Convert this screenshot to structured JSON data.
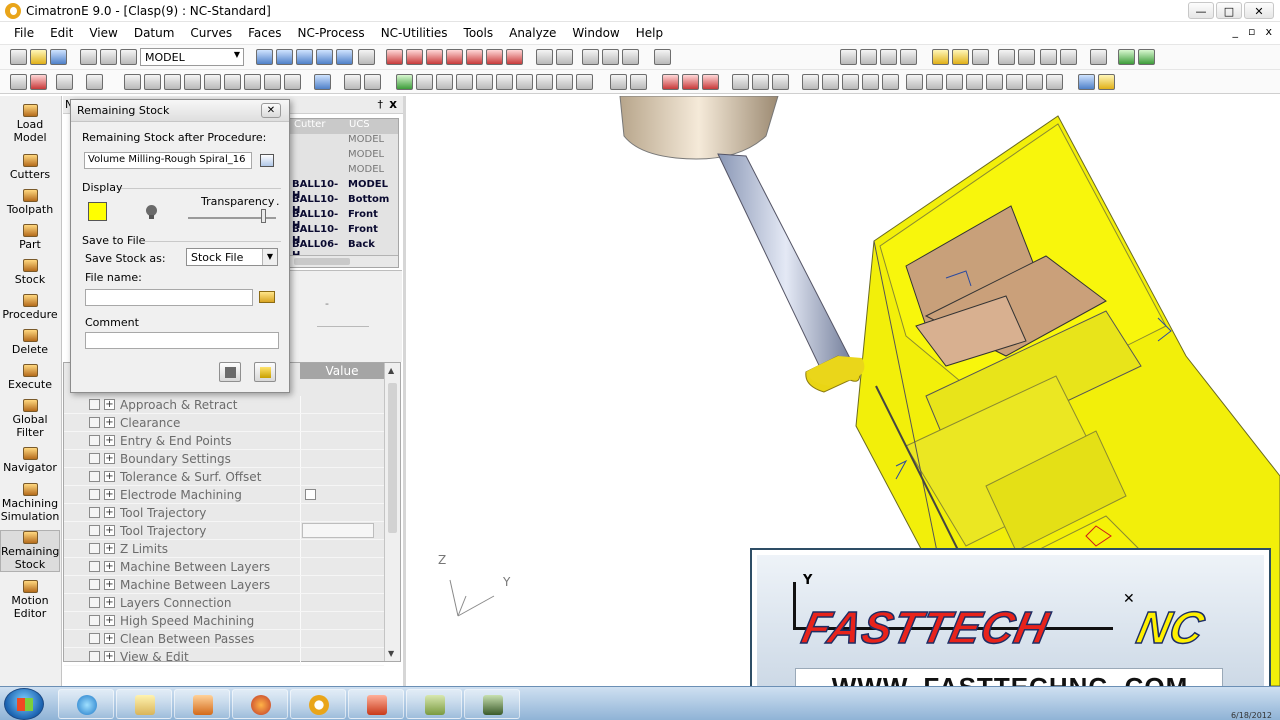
{
  "window": {
    "title": "CimatronE 9.0 - [Clasp(9) : NC-Standard]",
    "min": "—",
    "max": "□",
    "close": "✕"
  },
  "menu": [
    "File",
    "Edit",
    "View",
    "Datum",
    "Curves",
    "Faces",
    "NC-Process",
    "NC-Utilities",
    "Tools",
    "Analyze",
    "Window",
    "Help"
  ],
  "toolbar": {
    "model_select": "MODEL"
  },
  "leftbar": [
    {
      "label": "Load Model"
    },
    {
      "label": "Cutters"
    },
    {
      "label": "Toolpath"
    },
    {
      "label": "Part"
    },
    {
      "label": "Stock"
    },
    {
      "label": "Procedure"
    },
    {
      "label": "Delete"
    },
    {
      "label": "Execute"
    },
    {
      "label": "Global Filter"
    },
    {
      "label": "Navigator"
    },
    {
      "label": "Machining Simulation"
    },
    {
      "label": "Remaining Stock"
    },
    {
      "label": "Motion Editor"
    }
  ],
  "panel": {
    "title_letter": "N",
    "pin": "†",
    "close": "x",
    "table_headers": [
      "Cutter",
      "UCS"
    ],
    "table_rows": [
      {
        "cutter": "",
        "ucs": "MODEL",
        "dim": true
      },
      {
        "cutter": "",
        "ucs": "MODEL",
        "dim": true
      },
      {
        "cutter": "",
        "ucs": "MODEL",
        "dim": true
      },
      {
        "cutter": "BALL10-H",
        "ucs": "MODEL",
        "dim": false
      },
      {
        "cutter": "BALL10-H",
        "ucs": "Bottom",
        "dim": false
      },
      {
        "cutter": "BALL10-H",
        "ucs": "Front",
        "dim": false
      },
      {
        "cutter": "BALL10-H",
        "ucs": "Front",
        "dim": false
      },
      {
        "cutter": "BALL06-H",
        "ucs": "Back",
        "dim": false
      }
    ],
    "mid_dash": "-"
  },
  "params": {
    "value_header": "Value",
    "rows": [
      {
        "label": "Approach & Retract",
        "value_type": "none"
      },
      {
        "label": "Clearance",
        "value_type": "none"
      },
      {
        "label": "Entry & End Points",
        "value_type": "none"
      },
      {
        "label": "Boundary Settings",
        "value_type": "none"
      },
      {
        "label": "Tolerance & Surf. Offset",
        "value_type": "none"
      },
      {
        "label": "Electrode Machining",
        "value_type": "checkbox"
      },
      {
        "label": "Tool Trajectory",
        "value_type": "none"
      },
      {
        "label": "Tool Trajectory",
        "value_type": "field"
      },
      {
        "label": "Z Limits",
        "value_type": "none"
      },
      {
        "label": "Machine Between Layers",
        "value_type": "none"
      },
      {
        "label": "Machine Between Layers",
        "value_type": "none"
      },
      {
        "label": "Layers Connection",
        "value_type": "none"
      },
      {
        "label": "High Speed Machining",
        "value_type": "none"
      },
      {
        "label": "Clean Between Passes",
        "value_type": "none"
      },
      {
        "label": "View & Edit",
        "value_type": "none"
      }
    ]
  },
  "dialog": {
    "title": "Remaining Stock",
    "close": "✕",
    "after_procedure_label": "Remaining Stock after Procedure:",
    "procedure_value": "Volume Milling-Rough Spiral_16",
    "display_label": "Display",
    "transparency_label": "Transparency",
    "transparency_dot": ".",
    "save_to_file_label": "Save to File",
    "save_stock_as_label": "Save Stock as:",
    "save_stock_as_value": "Stock File",
    "file_name_label": "File name:",
    "file_name_value": "",
    "comment_label": "Comment",
    "comment_value": "",
    "stock_color": "#ffff00"
  },
  "viewport": {
    "triad_z": "Z",
    "triad_y": "Y"
  },
  "overlay": {
    "logo_text": "FASTTECH",
    "logo_nc": "NC",
    "url": "WWW. FASTTECHNC .COM",
    "y_label": "Y",
    "x_label": "✕"
  },
  "taskbar": {
    "apps": [
      "internet-explorer",
      "file-explorer",
      "media-player",
      "firefox",
      "cimatron",
      "presentation",
      "notes",
      "dvd-maker"
    ],
    "date": "6/18/2012"
  }
}
